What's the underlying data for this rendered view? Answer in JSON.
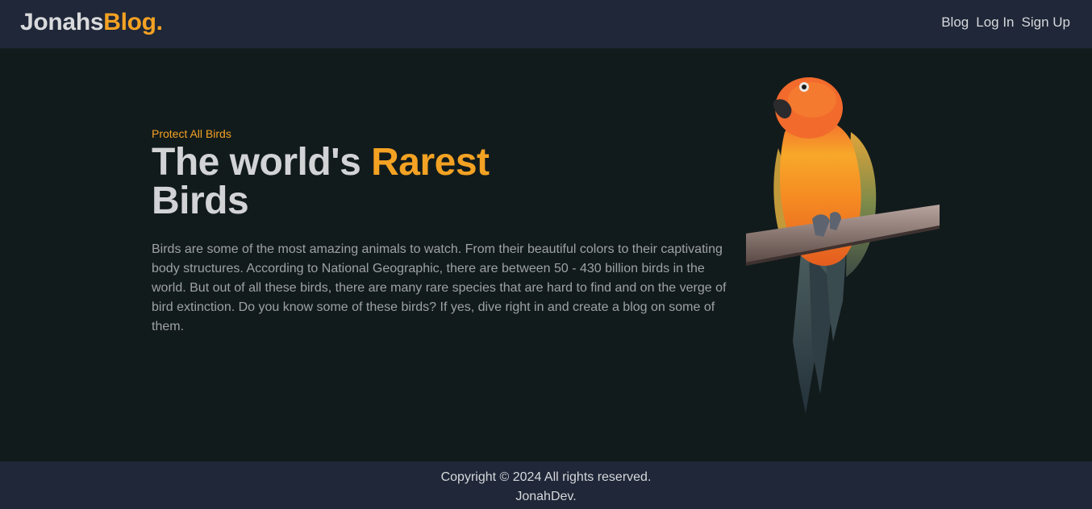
{
  "navbar": {
    "brand_main": "Jonahs",
    "brand_accent": "Blog.",
    "links": [
      "Blog",
      "Log In",
      "Sign Up"
    ]
  },
  "hero": {
    "eyebrow": "Protect All Birds",
    "headline_part1": "The world's ",
    "headline_accent": "Rarest",
    "headline_part2": "Birds",
    "description": "Birds are some of the most amazing animals to watch. From their beautiful colors to their captivating body structures. According to National Geographic, there are between 50 - 430 billion birds in the world. But out of all these birds, there are many rare species that are hard to find and on the verge of bird extinction. Do you know some of these birds? If yes, dive right in and create a blog on some of them.",
    "image_alt": "parrot-image"
  },
  "footer": {
    "copyright": "Copyright © 2024 All rights reserved.",
    "author": "JonahDev."
  },
  "colors": {
    "background": "#121b1c",
    "bar": "#1f2738",
    "accent": "#f4a223",
    "heading": "#d2d3d5",
    "body_text": "#9ea1a6"
  }
}
